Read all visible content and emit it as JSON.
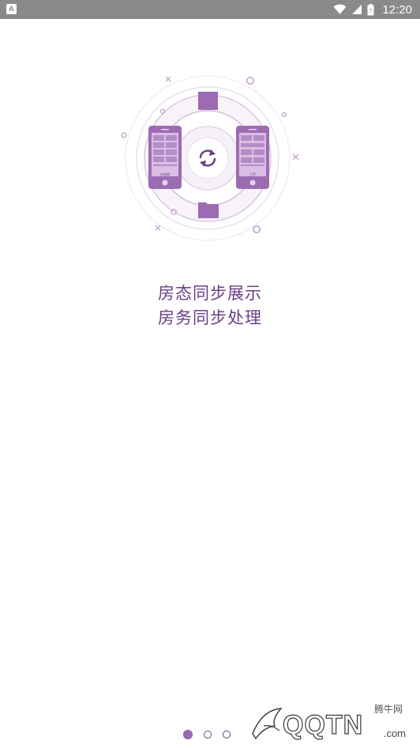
{
  "status_bar": {
    "notification_icon": "app-notification-icon",
    "icons": [
      "wifi-icon",
      "signal-icon",
      "battery-icon"
    ],
    "time": "12:20"
  },
  "hero": {
    "icon": "sync-icon",
    "phone_left_label": "房态图",
    "phone_right_label": "工作",
    "accent_color": "#9c6cb3"
  },
  "headline": {
    "line1": "房态同步展示",
    "line2": "房务同步处理"
  },
  "pager": {
    "current": 1,
    "total": 3
  },
  "watermark": {
    "top": "腾牛网",
    "main": "QQTN",
    "tail": ".com"
  }
}
